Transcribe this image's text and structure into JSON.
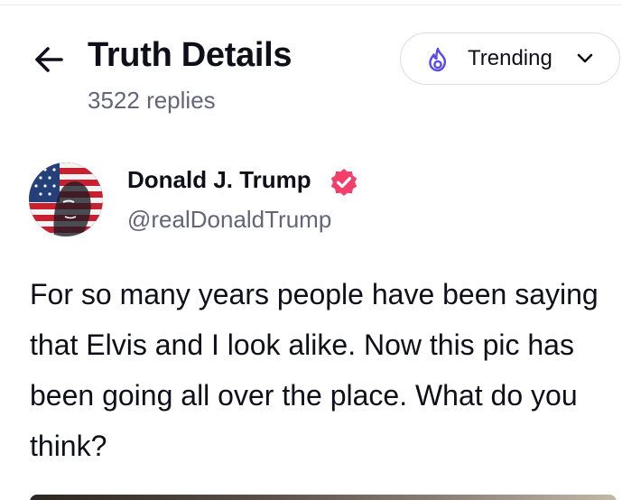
{
  "header": {
    "back_icon": "arrow-left-icon",
    "title": "Truth Details",
    "subtitle": "3522 replies"
  },
  "sort_dropdown": {
    "icon": "flame-icon",
    "selected": "Trending",
    "chevron_icon": "chevron-down-icon",
    "accent_color": "#5448ee"
  },
  "post": {
    "author": {
      "name": "Donald J. Trump",
      "handle": "@realDonaldTrump",
      "verified": true,
      "badge_color": "#f2406a"
    },
    "text": "For so many years people have been saying that Elvis and I look alike. Now this pic has been going all over the place. What do you think?"
  },
  "colors": {
    "text_primary": "#0f0f1a",
    "text_secondary": "#64647a",
    "border": "#dcdce4"
  }
}
